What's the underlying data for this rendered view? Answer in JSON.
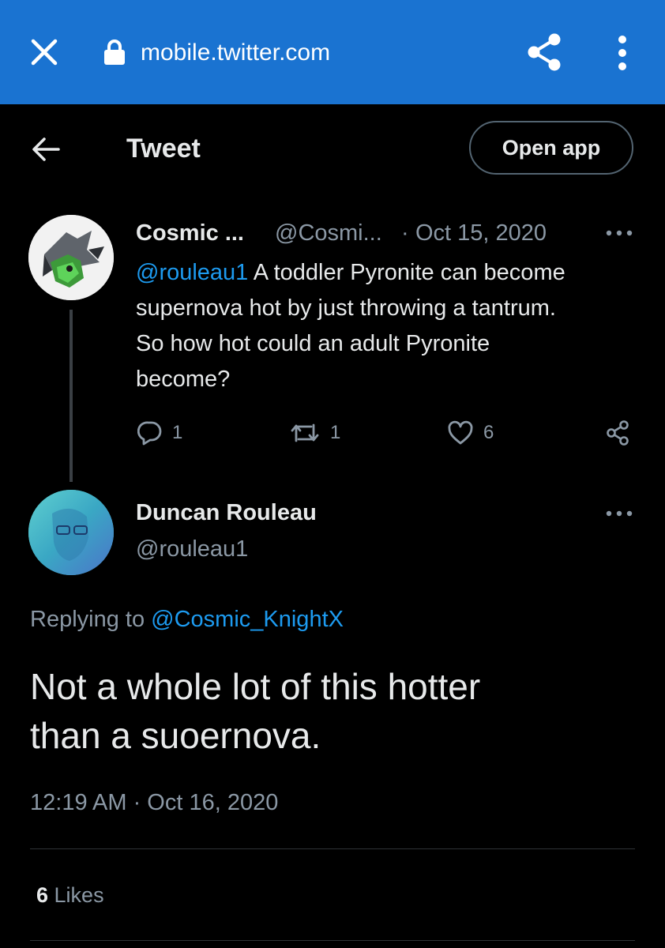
{
  "browser": {
    "url": "mobile.twitter.com",
    "bar_color": "#1a73d1",
    "icons": {
      "close": "close-icon",
      "lock": "lock-icon",
      "share": "share-icon",
      "menu": "more-vertical-icon"
    }
  },
  "header": {
    "title": "Tweet",
    "open_app_label": "Open app",
    "back_icon": "arrow-left-icon"
  },
  "parent_tweet": {
    "name": "Cosmic ...",
    "handle": "@Cosmi...",
    "separator": "·",
    "date": "Oct 15, 2020",
    "mention": "@rouleau1",
    "text": " A toddler Pyronite can become\nsupernova hot by just throwing a tantrum.\nSo how hot could an adult Pyronite\nbecome?",
    "reply_count": "1",
    "retweet_count": "1",
    "like_count": "6"
  },
  "main_tweet": {
    "name": "Duncan Rouleau",
    "handle": "@rouleau1",
    "replying_prefix": "Replying to ",
    "replying_to": "@Cosmic_KnightX",
    "text": "Not a whole lot of this hotter\nthan a suoernova.",
    "timestamp": "12:19 AM · Oct 16, 2020",
    "likes_count": "6",
    "likes_label": " Likes"
  },
  "colors": {
    "background": "#000000",
    "text_primary": "#e7e9ea",
    "text_secondary": "#8b98a5",
    "link": "#1d9bf0"
  }
}
